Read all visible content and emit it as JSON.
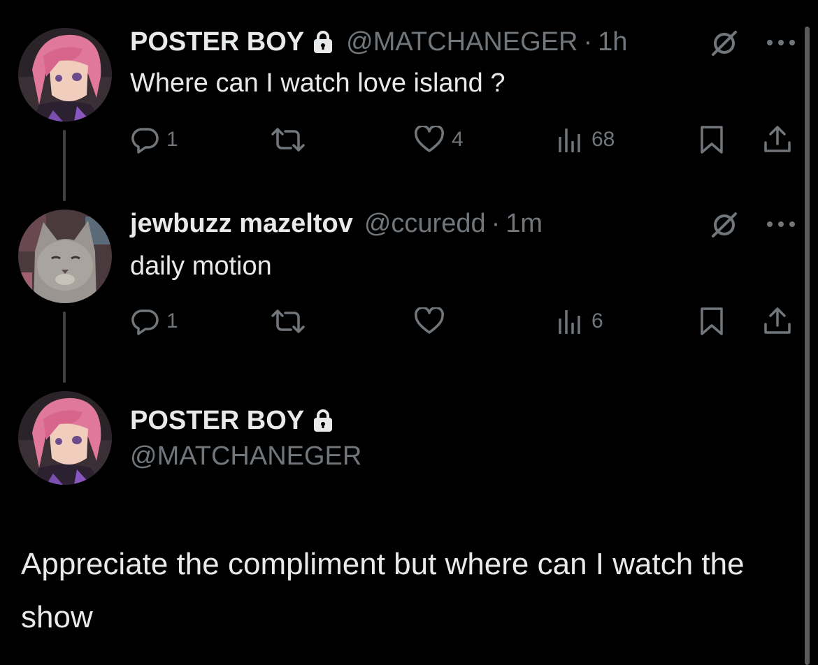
{
  "tweets": [
    {
      "display_name": "POSTER BOY",
      "handle": "@MATCHANEGER",
      "separator": "·",
      "time": "1h",
      "text": "Where can I watch love island ?",
      "replies": "1",
      "likes": "4",
      "views": "68",
      "avatar_icon": "anime-girl-avatar"
    },
    {
      "display_name": "jewbuzz mazeltov",
      "handle": "@ccuredd",
      "separator": "·",
      "time": "1m",
      "text": "daily motion",
      "replies": "1",
      "likes": "",
      "views": "6",
      "avatar_icon": "cat-avatar"
    }
  ],
  "reply_composer": {
    "display_name": "POSTER BOY",
    "handle": "@MATCHANEGER",
    "text": "Appreciate the compliment but where can I watch the show"
  },
  "icons": [
    "lock-icon",
    "grok-icon",
    "more-icon",
    "reply-icon",
    "retweet-icon",
    "like-icon",
    "views-icon",
    "bookmark-icon",
    "share-icon"
  ],
  "colors": {
    "background": "#000000",
    "text_primary": "#e7e9ea",
    "text_secondary": "#71767b"
  }
}
